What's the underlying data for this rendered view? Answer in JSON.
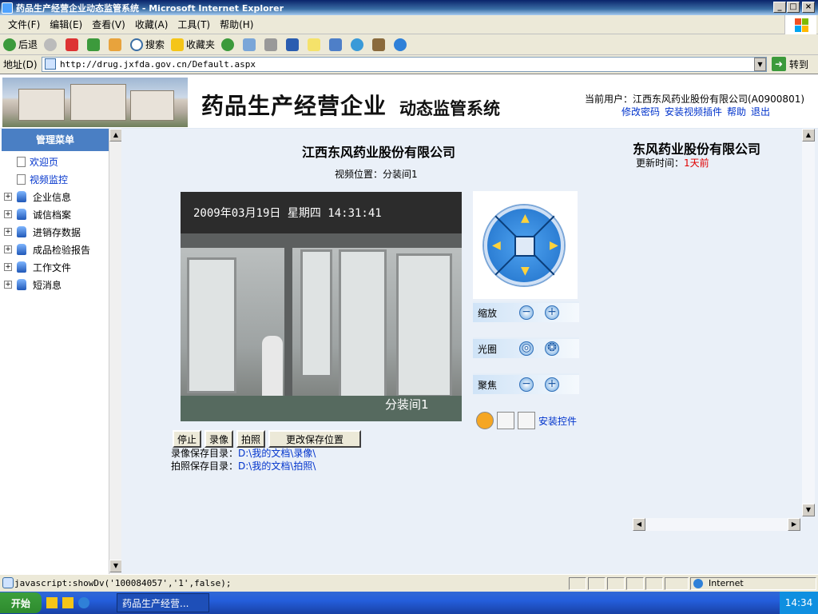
{
  "window": {
    "title": "药品生产经营企业动态监管系统 - Microsoft Internet Explorer"
  },
  "menu": [
    "文件(F)",
    "编辑(E)",
    "查看(V)",
    "收藏(A)",
    "工具(T)",
    "帮助(H)"
  ],
  "toolbar": {
    "back": "后退",
    "search": "搜索",
    "favorites": "收藏夹"
  },
  "address": {
    "label": "地址(D)",
    "url": "http://drug.jxfda.gov.cn/Default.aspx",
    "go": "转到"
  },
  "header": {
    "title": "药品生产经营企业",
    "subtitle": "动态监管系统",
    "current_user": "当前用户：江西东风药业股份有限公司(A0900801)",
    "links": [
      "修改密码",
      "安装视频插件",
      "帮助",
      "退出"
    ]
  },
  "sidebar": {
    "title": "管理菜单",
    "items": [
      {
        "label": "欢迎页"
      },
      {
        "label": "视频监控"
      },
      {
        "label": "企业信息"
      },
      {
        "label": "诚信档案"
      },
      {
        "label": "进销存数据"
      },
      {
        "label": "成品检验报告"
      },
      {
        "label": "工作文件"
      },
      {
        "label": "短消息"
      }
    ]
  },
  "main": {
    "company": "江西东风药业股份有限公司",
    "location": "视频位置：分装间1",
    "video_timestamp": "2009年03月19日 星期四 14:31:41",
    "video_label": "分装间1",
    "controls": {
      "zoom": "缩放",
      "iris": "光圈",
      "focus": "聚焦"
    },
    "install_link": "安装控件",
    "buttons": {
      "stop": "停止",
      "record": "录像",
      "snapshot": "拍照",
      "change": "更改保存位置"
    },
    "record_dir_label": "录像保存目录：",
    "record_dir": "D:\\我的文档\\录像\\",
    "snap_dir_label": "拍照保存目录：",
    "snap_dir": "D:\\我的文档\\拍照\\",
    "side_company": "东风药业股份有限公司",
    "update_label": "更新时间：",
    "update_value": "1天前"
  },
  "status": {
    "text": "javascript:showDv('100084057','1',false);",
    "zone": "Internet"
  },
  "taskbar": {
    "start": "开始",
    "task": "药品生产经营...",
    "clock": "14:34"
  }
}
